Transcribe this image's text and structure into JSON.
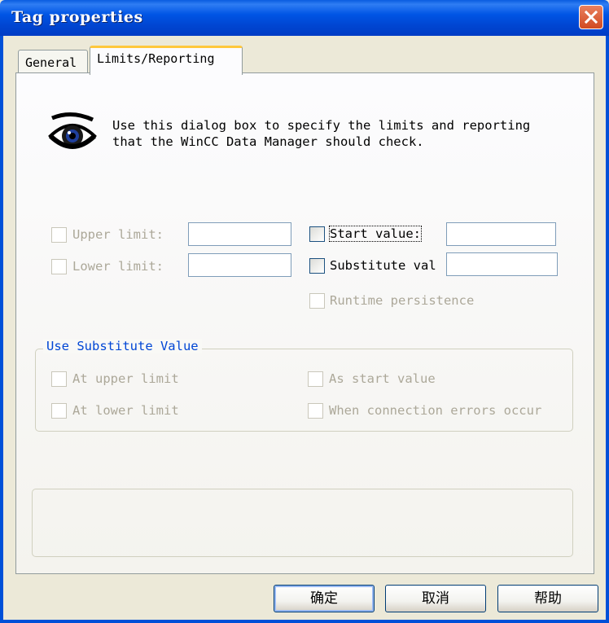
{
  "window": {
    "title": "Tag properties",
    "close_icon": "close-icon"
  },
  "tabs": [
    {
      "label": "General",
      "active": false
    },
    {
      "label": "Limits/Reporting",
      "active": true
    }
  ],
  "info": {
    "icon": "eye-icon",
    "text": "Use this dialog box to specify the limits and reporting\nthat the WinCC Data Manager should check."
  },
  "limits": {
    "upper_limit": {
      "label": "Upper limit:",
      "checked": false,
      "enabled": false,
      "value": ""
    },
    "lower_limit": {
      "label": "Lower limit:",
      "checked": false,
      "enabled": false,
      "value": ""
    },
    "start_value": {
      "label": "Start value:",
      "checked": false,
      "enabled": true,
      "value": ""
    },
    "substitute_value": {
      "label": "Substitute val",
      "checked": false,
      "enabled": true,
      "value": ""
    },
    "runtime_persistence": {
      "label": "Runtime persistence",
      "checked": false,
      "enabled": false
    }
  },
  "substitute_group": {
    "title": "Use Substitute Value",
    "at_upper_limit": {
      "label": "At upper limit",
      "checked": false,
      "enabled": false
    },
    "at_lower_limit": {
      "label": "At lower limit",
      "checked": false,
      "enabled": false
    },
    "as_start_value": {
      "label": "As start value",
      "checked": false,
      "enabled": false
    },
    "connection_errors": {
      "label": "When connection errors occur",
      "checked": false,
      "enabled": false
    }
  },
  "status_text": "",
  "buttons": {
    "ok": "确定",
    "cancel": "取消",
    "help": "帮助"
  },
  "colors": {
    "titlebar": "#0055e5",
    "tab_highlight": "#ffc83c",
    "group_title": "#0046d5",
    "disabled_text": "#aca899"
  }
}
